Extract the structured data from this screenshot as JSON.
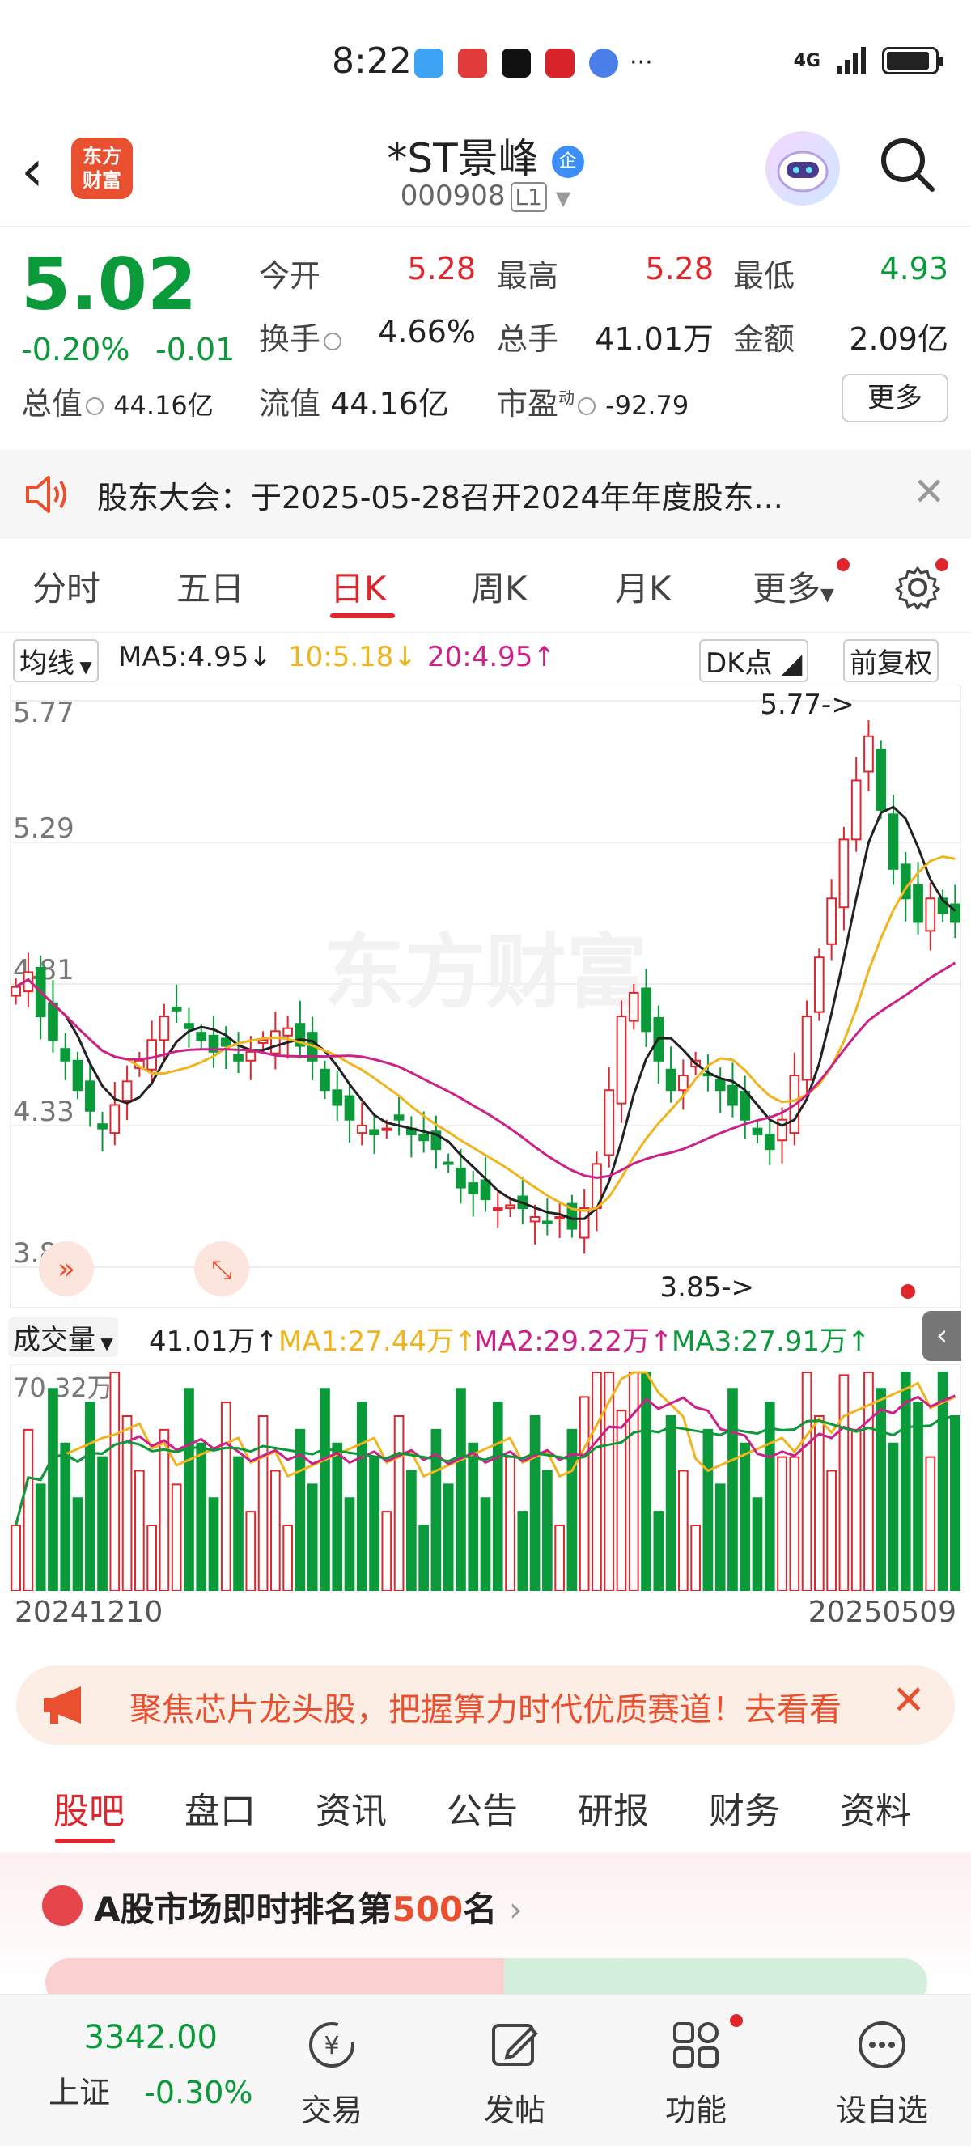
{
  "status_bar": {
    "time": "8:22",
    "signal": "4G",
    "more": "···"
  },
  "header": {
    "title": "*ST景峰",
    "badge": "企",
    "code": "000908",
    "level": "L1",
    "logo_line1": "东方",
    "logo_line2": "财富"
  },
  "quote": {
    "price": "5.02",
    "change_pct": "-0.20%",
    "change": "-0.01",
    "rows": [
      [
        {
          "label": "今开",
          "value": "5.28",
          "color": "red"
        },
        {
          "label": "最高",
          "value": "5.28",
          "color": "red"
        },
        {
          "label": "最低",
          "value": "4.93",
          "color": "green"
        }
      ],
      [
        {
          "label": "换手",
          "value": "4.66%",
          "color": "dark"
        },
        {
          "label": "总手",
          "value": "41.01万",
          "color": "dark"
        },
        {
          "label": "金额",
          "value": "2.09亿",
          "color": "dark"
        }
      ]
    ],
    "row3": {
      "zongzhi_label": "总值",
      "zongzhi": "44.16亿",
      "liuzhi_label": "流值",
      "liuzhi": "44.16亿",
      "shiying_label": "市盈",
      "shiying_sup": "动",
      "shiying": "-92.79"
    },
    "more": "更多"
  },
  "notice": {
    "text": "股东大会：于2025-05-28召开2024年年度股东..."
  },
  "tabs": [
    "分时",
    "五日",
    "日K",
    "周K",
    "月K",
    "更多"
  ],
  "indicator": {
    "type": "均线",
    "ma5": "MA5:4.95",
    "ma10": "10:5.18",
    "ma20": "20:4.95",
    "dk": "DK点",
    "fq": "前复权"
  },
  "volume_header": {
    "label": "成交量",
    "vol": "41.01万",
    "ma1": "MA1:27.44万",
    "ma2": "MA2:29.22万",
    "ma3": "MA3:27.91万"
  },
  "dates": {
    "start": "20241210",
    "end": "20250509"
  },
  "promo": {
    "text": "聚焦芯片龙头股，把握算力时代优质赛道！去看看"
  },
  "bottom_tabs": [
    "股吧",
    "盘口",
    "资讯",
    "公告",
    "研报",
    "财务",
    "资料"
  ],
  "rank": {
    "prefix": "A股市场即时排名第",
    "num": "500",
    "suffix": "名"
  },
  "bottom_nav": {
    "index_value": "3342.00",
    "index_name": "上证",
    "index_chg": "-0.30%",
    "items": [
      "交易",
      "发帖",
      "功能",
      "设自选"
    ]
  },
  "chart_data": {
    "type": "candlestick",
    "ylim": [
      3.85,
      5.77
    ],
    "price_labels": [
      "5.77",
      "5.29",
      "4.81",
      "4.33",
      "3.85"
    ],
    "high_marker": "5.77->",
    "low_marker": "3.85->",
    "volume_max_label": "70.32万",
    "watermark": "东方财富",
    "colors": {
      "up": "#e0262d",
      "down": "#0a9a3a",
      "ma5": "#222222",
      "ma10": "#f0b41e",
      "ma20": "#cc2288"
    },
    "close": [
      4.8,
      4.85,
      4.7,
      4.62,
      4.55,
      4.45,
      4.38,
      4.32,
      4.4,
      4.48,
      4.55,
      4.62,
      4.7,
      4.72,
      4.66,
      4.62,
      4.58,
      4.6,
      4.55,
      4.58,
      4.62,
      4.65,
      4.66,
      4.6,
      4.55,
      4.45,
      4.4,
      4.35,
      4.33,
      4.3,
      4.32,
      4.35,
      4.3,
      4.28,
      4.25,
      4.2,
      4.12,
      4.1,
      4.08,
      4.05,
      4.06,
      4.05,
      4.02,
      4.0,
      4.02,
      3.98,
      4.05,
      4.2,
      4.45,
      4.7,
      4.78,
      4.65,
      4.55,
      4.45,
      4.5,
      4.55,
      4.5,
      4.45,
      4.4,
      4.35,
      4.3,
      4.25,
      4.35,
      4.5,
      4.7,
      4.9,
      5.1,
      5.3,
      5.5,
      5.65,
      5.4,
      5.2,
      5.1,
      5.02,
      5.1,
      5.05,
      5.02
    ]
  }
}
